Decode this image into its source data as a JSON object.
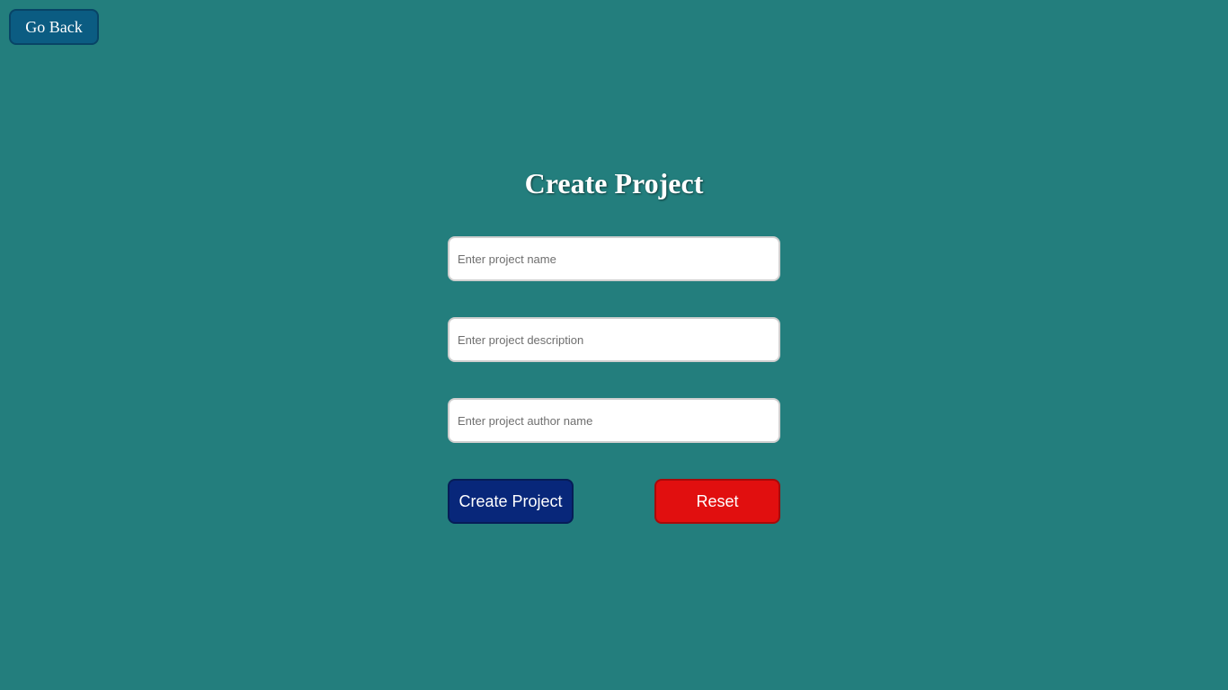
{
  "nav": {
    "back_label": "Go Back"
  },
  "form": {
    "title": "Create Project",
    "name_placeholder": "Enter project name",
    "name_value": "",
    "description_placeholder": "Enter project description",
    "description_value": "",
    "author_placeholder": "Enter project author name",
    "author_value": "",
    "create_label": "Create Project",
    "reset_label": "Reset"
  },
  "colors": {
    "background": "#237e7d",
    "back_button": "#0b5c82",
    "create_button": "#08277a",
    "reset_button": "#e10f0f"
  }
}
